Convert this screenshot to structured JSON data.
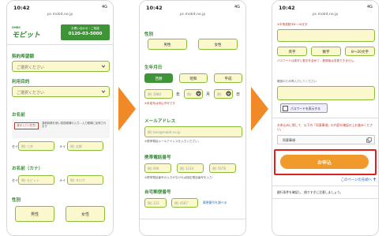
{
  "status": {
    "time": "10:42",
    "signal": "4G",
    "url": "pc.mobit.ne.jp"
  },
  "phone1": {
    "logo_top": "SMBC",
    "logo": "モビット",
    "contact_title": "お問い合わせ・ご相談",
    "contact_phone": "0120-03-5000",
    "sections": [
      {
        "label": "契約希望額",
        "placeholder": "ご選択ください"
      },
      {
        "label": "利用目的",
        "placeholder": "ご選択ください"
      }
    ],
    "name_label": "お名前",
    "name_badge": "漢字入力 (任意)",
    "name_note": "漢和辞典を使い変換候補の入力…入力候補に反映されます",
    "sei": "セイ",
    "mei": "メイ",
    "name_ph": [
      "例) 三井",
      "例) 太郎"
    ],
    "kana_label": "お名前（カナ）",
    "kana_ph": [
      "例) モビット",
      "例) タロウ"
    ],
    "gender_label": "性別",
    "male": "男性",
    "female": "女性"
  },
  "phone2": {
    "gender_label": "性別",
    "male": "男性",
    "female": "女性",
    "birth_label": "生年月日",
    "eras": [
      "西暦",
      "昭和",
      "平成"
    ],
    "year_ph": "例) 1980",
    "year_unit": "年",
    "month_ph": "例)",
    "month_unit": "月",
    "day_ph": "例)",
    "day_unit": "日",
    "birth_note": "※未成年は申込不可です",
    "email_label": "メールアドレス",
    "email_ph": "例) taro@mobit.ne.jp",
    "email_note": "※携帯電話メールアドレスを入力ください。",
    "phone_label": "携帯電話番号",
    "phone_ph": [
      "例) 090",
      "例) 1234",
      "例) 5678"
    ],
    "phone_note": "※携帯電話番号の入力がなければ固定電話番号を入力",
    "home_label": "自宅郵便番号",
    "zip_ph": [
      "例) 123",
      "例) 4567"
    ],
    "zip_link": "郵便番号を調べる"
  },
  "phone3": {
    "top_note": "※半角英数字8～16文字",
    "pw_types": [
      "英字",
      "数字",
      "8～20文字"
    ],
    "pw_notes": "パスワードは英字と数字を含めて…登録後は変更できません。",
    "pw_confirm_label": "確認のため再入力してください",
    "show_pw": "パスワードを表示する",
    "agree_note": "お申込みに際して、以下の「同意事項」の内容を確認の上お進みください。",
    "agree_label": "同意事項",
    "apply": "お申込",
    "top_link": "このページの先頭へ",
    "bottom_note": "銀行条件を確認し、借りすぎに注意しましょう。"
  }
}
